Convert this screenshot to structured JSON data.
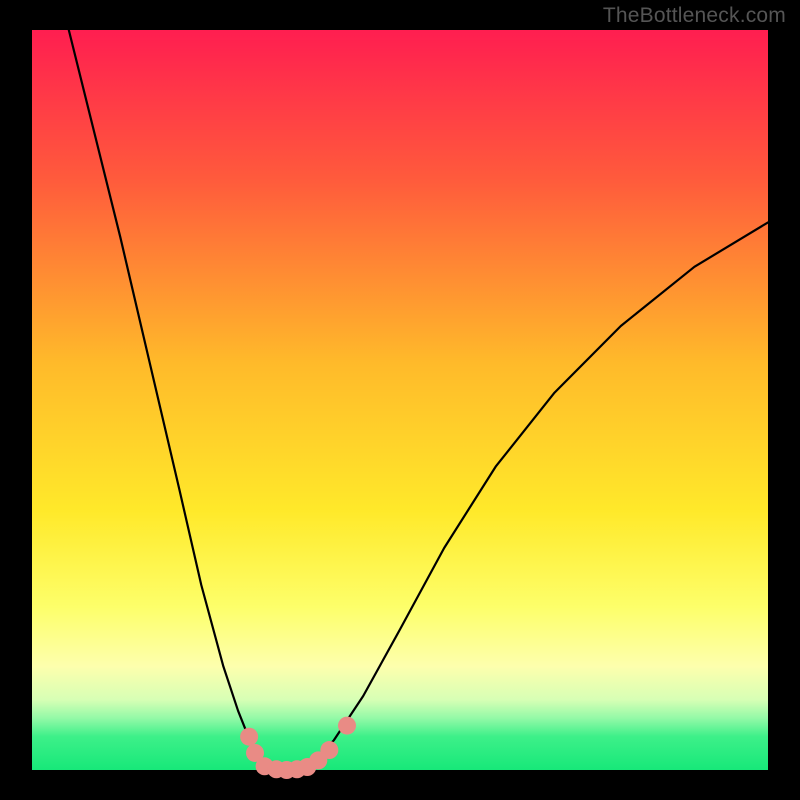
{
  "watermark": "TheBottleneck.com",
  "chart_data": {
    "type": "line",
    "title": "",
    "xlabel": "",
    "ylabel": "",
    "xlim": [
      0,
      100
    ],
    "ylim": [
      0,
      100
    ],
    "grid": false,
    "legend": false,
    "background_gradient": {
      "stops": [
        {
          "offset": 0.0,
          "color": "#ff1e50"
        },
        {
          "offset": 0.2,
          "color": "#ff5a3c"
        },
        {
          "offset": 0.45,
          "color": "#ffba2a"
        },
        {
          "offset": 0.65,
          "color": "#ffe92a"
        },
        {
          "offset": 0.78,
          "color": "#fdff6a"
        },
        {
          "offset": 0.86,
          "color": "#fdffad"
        },
        {
          "offset": 0.905,
          "color": "#d7ffb5"
        },
        {
          "offset": 0.93,
          "color": "#93f9a7"
        },
        {
          "offset": 0.955,
          "color": "#3df089"
        },
        {
          "offset": 1.0,
          "color": "#17e879"
        }
      ]
    },
    "series": [
      {
        "name": "bottleneck-curve",
        "type": "line",
        "color": "#000000",
        "stroke_width": 2.2,
        "points": [
          {
            "x": 5.0,
            "y": 100.0
          },
          {
            "x": 8.0,
            "y": 88.0
          },
          {
            "x": 12.0,
            "y": 72.0
          },
          {
            "x": 16.0,
            "y": 55.0
          },
          {
            "x": 20.0,
            "y": 38.0
          },
          {
            "x": 23.0,
            "y": 25.0
          },
          {
            "x": 26.0,
            "y": 14.0
          },
          {
            "x": 28.0,
            "y": 8.0
          },
          {
            "x": 30.0,
            "y": 3.0
          },
          {
            "x": 32.0,
            "y": 0.5
          },
          {
            "x": 34.0,
            "y": 0.0
          },
          {
            "x": 36.0,
            "y": 0.0
          },
          {
            "x": 38.0,
            "y": 1.0
          },
          {
            "x": 41.0,
            "y": 4.0
          },
          {
            "x": 45.0,
            "y": 10.0
          },
          {
            "x": 50.0,
            "y": 19.0
          },
          {
            "x": 56.0,
            "y": 30.0
          },
          {
            "x": 63.0,
            "y": 41.0
          },
          {
            "x": 71.0,
            "y": 51.0
          },
          {
            "x": 80.0,
            "y": 60.0
          },
          {
            "x": 90.0,
            "y": 68.0
          },
          {
            "x": 100.0,
            "y": 74.0
          }
        ]
      },
      {
        "name": "trough-markers",
        "type": "scatter",
        "color": "#e98b85",
        "radius": 9,
        "points": [
          {
            "x": 29.5,
            "y": 4.5
          },
          {
            "x": 30.3,
            "y": 2.3
          },
          {
            "x": 31.6,
            "y": 0.5
          },
          {
            "x": 33.2,
            "y": 0.1
          },
          {
            "x": 34.6,
            "y": 0.0
          },
          {
            "x": 36.0,
            "y": 0.1
          },
          {
            "x": 37.4,
            "y": 0.4
          },
          {
            "x": 38.9,
            "y": 1.3
          },
          {
            "x": 40.4,
            "y": 2.7
          },
          {
            "x": 42.8,
            "y": 6.0
          }
        ]
      }
    ]
  }
}
